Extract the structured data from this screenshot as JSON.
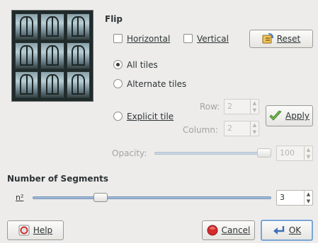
{
  "flip": {
    "heading": "Flip",
    "horizontal": {
      "label": "Horizontal",
      "checked": false
    },
    "vertical": {
      "label": "Vertical",
      "checked": false
    },
    "reset_label": "Reset"
  },
  "tiles": {
    "all": {
      "label": "All tiles",
      "selected": true
    },
    "alternate": {
      "label": "Alternate tiles",
      "selected": false
    },
    "explicit": {
      "label": "Explicit tile",
      "selected": false
    },
    "row_label": "Row:",
    "row_value": "2",
    "column_label": "Column:",
    "column_value": "2",
    "apply_label": "Apply"
  },
  "opacity": {
    "label": "Opacity:",
    "value": "100",
    "fraction": 1.0
  },
  "segments": {
    "heading": "Number of Segments",
    "label": "n²",
    "value": "3",
    "fraction": 0.27
  },
  "buttons": {
    "help": "Help",
    "cancel": "Cancel",
    "ok": "OK"
  }
}
